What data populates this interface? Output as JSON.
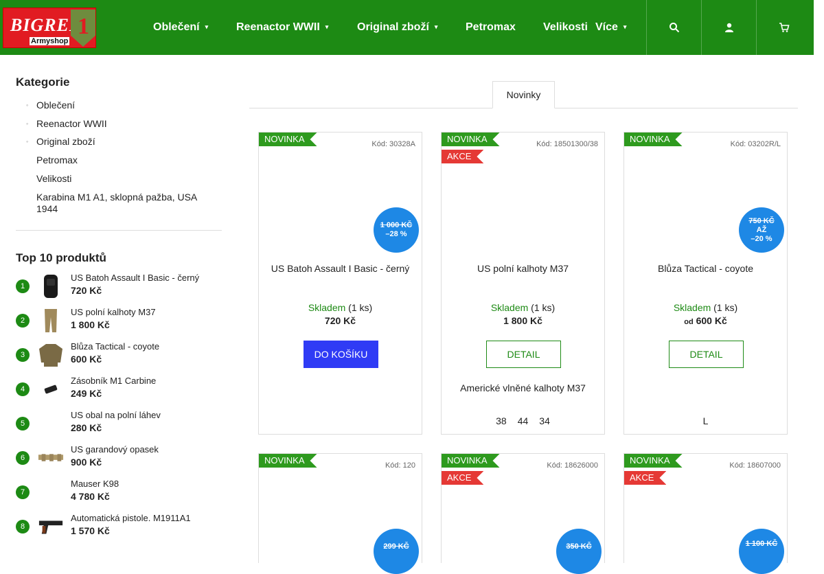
{
  "header": {
    "logo_main": "BIGRED",
    "logo_number": "1",
    "logo_sub": "Armyshop",
    "nav": [
      {
        "label": "Oblečení",
        "has_caret": true
      },
      {
        "label": "Reenactor WWII",
        "has_caret": true
      },
      {
        "label": "Original zboží",
        "has_caret": true
      },
      {
        "label": "Petromax",
        "has_caret": false
      },
      {
        "label": "Velikosti",
        "has_caret": false
      },
      {
        "label": "Více",
        "has_caret": true
      }
    ],
    "icons": [
      "search-icon",
      "user-icon",
      "cart-icon"
    ]
  },
  "sidebar": {
    "categories_title": "Kategorie",
    "categories": [
      {
        "label": "Oblečení",
        "bullet": true
      },
      {
        "label": "Reenactor WWII",
        "bullet": true
      },
      {
        "label": "Original zboží",
        "bullet": true
      },
      {
        "label": "Petromax",
        "bullet": false
      },
      {
        "label": "Velikosti",
        "bullet": false
      },
      {
        "label": "Karabina M1 A1, sklopná pažba, USA 1944",
        "bullet": false
      }
    ],
    "top10_title": "Top 10 produktů",
    "top10": [
      {
        "rank": "1",
        "name": "US Batoh Assault I Basic - černý",
        "price": "720 Kč"
      },
      {
        "rank": "2",
        "name": "US polní kalhoty M37",
        "price": "1 800 Kč"
      },
      {
        "rank": "3",
        "name": "Blůza Tactical - coyote",
        "price": "600 Kč"
      },
      {
        "rank": "4",
        "name": "Zásobník M1 Carbine",
        "price": "249 Kč"
      },
      {
        "rank": "5",
        "name": "US obal na polní láhev",
        "price": "280 Kč"
      },
      {
        "rank": "6",
        "name": "US garandový opasek",
        "price": "900 Kč"
      },
      {
        "rank": "7",
        "name": "Mauser K98",
        "price": "4 780 Kč"
      },
      {
        "rank": "8",
        "name": "Automatická pistole. M1911A1",
        "price": "1 570 Kč"
      }
    ]
  },
  "tabs": {
    "active": "Novinky"
  },
  "products": [
    {
      "flag_new": "NOVINKA",
      "flag_sale": "",
      "code": "Kód: 30328A",
      "disc_old": "1 000 KČ",
      "disc_mid": "",
      "disc_pct": "–28 %",
      "name": "US Batoh Assault I Basic - černý",
      "stock": "Skladem",
      "qty": "(1 ks)",
      "price_prefix": "",
      "price": "720 Kč",
      "button": "DO KOŠÍKU",
      "button_type": "cart",
      "subtitle": "",
      "variants": []
    },
    {
      "flag_new": "NOVINKA",
      "flag_sale": "AKCE",
      "code": "Kód: 18501300/38",
      "disc_old": "",
      "disc_mid": "",
      "disc_pct": "",
      "name": "US polní kalhoty M37",
      "stock": "Skladem",
      "qty": "(1 ks)",
      "price_prefix": "",
      "price": "1 800 Kč",
      "button": "DETAIL",
      "button_type": "detail",
      "subtitle": "Americké vlněné kalhoty M37",
      "variants": [
        "38",
        "44",
        "34"
      ]
    },
    {
      "flag_new": "NOVINKA",
      "flag_sale": "",
      "code": "Kód: 03202R/L",
      "disc_old": "750 KČ",
      "disc_mid": "AŽ",
      "disc_pct": "–20 %",
      "name": "Blůza Tactical - coyote",
      "stock": "Skladem",
      "qty": "(1 ks)",
      "price_prefix": "od",
      "price": "600 Kč",
      "button": "DETAIL",
      "button_type": "detail",
      "subtitle": "",
      "variants": [
        "L"
      ]
    },
    {
      "flag_new": "NOVINKA",
      "flag_sale": "",
      "code": "Kód: 120",
      "disc_old": "299 KČ",
      "disc_mid": "",
      "disc_pct": "",
      "name": "",
      "stock": "",
      "qty": "",
      "price_prefix": "",
      "price": "",
      "button": "",
      "button_type": "",
      "subtitle": "",
      "variants": []
    },
    {
      "flag_new": "NOVINKA",
      "flag_sale": "AKCE",
      "code": "Kód: 18626000",
      "disc_old": "350 KČ",
      "disc_mid": "",
      "disc_pct": "",
      "name": "",
      "stock": "",
      "qty": "",
      "price_prefix": "",
      "price": "",
      "button": "",
      "button_type": "",
      "subtitle": "",
      "variants": []
    },
    {
      "flag_new": "NOVINKA",
      "flag_sale": "AKCE",
      "code": "Kód: 18607000",
      "disc_old": "1 100 KČ",
      "disc_mid": "",
      "disc_pct": "",
      "name": "",
      "stock": "",
      "qty": "",
      "price_prefix": "",
      "price": "",
      "button": "",
      "button_type": "",
      "subtitle": "",
      "variants": []
    }
  ]
}
